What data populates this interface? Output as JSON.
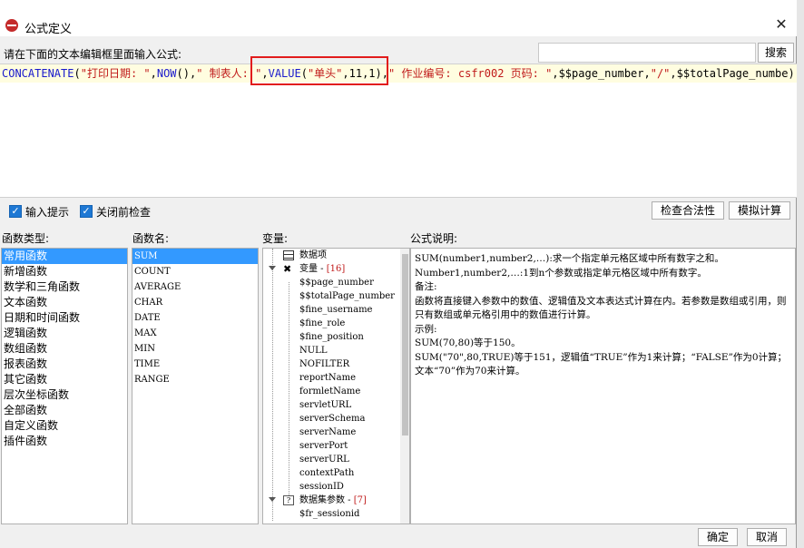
{
  "window": {
    "title": "公式定义",
    "close_glyph": "✕"
  },
  "prompt_label": "请在下面的文本编辑框里面输入公式:",
  "search": {
    "value": "",
    "button_label": "搜索"
  },
  "formula": {
    "segments": [
      {
        "text": "CONCATENATE",
        "kind": "fn"
      },
      {
        "text": "(",
        "kind": "punct"
      },
      {
        "text": "\"打印日期: \"",
        "kind": "str"
      },
      {
        "text": ",",
        "kind": "punct"
      },
      {
        "text": "NOW",
        "kind": "fn"
      },
      {
        "text": "(),",
        "kind": "punct"
      },
      {
        "text": "\" 制表人: \"",
        "kind": "str"
      },
      {
        "text": ",",
        "kind": "punct"
      },
      {
        "text": "VALUE",
        "kind": "fn"
      },
      {
        "text": "(",
        "kind": "punct"
      },
      {
        "text": "\"单头\"",
        "kind": "str"
      },
      {
        "text": ",11,1),",
        "kind": "punct"
      },
      {
        "text": "\" 作业编号: csfr002 页码: \"",
        "kind": "str"
      },
      {
        "text": ",$$page_number,",
        "kind": "punct"
      },
      {
        "text": "\"/\"",
        "kind": "str"
      },
      {
        "text": ",$$totalPage_numbe)",
        "kind": "punct"
      }
    ],
    "overflow_glyph": "ý"
  },
  "options": {
    "input_hint_label": "输入提示",
    "check_before_close_label": "关闭前检查",
    "input_hint_checked": true,
    "check_before_close_checked": true,
    "check_validity_button": "检查合法性",
    "simulate_button": "模拟计算"
  },
  "function_types": {
    "label": "函数类型:",
    "items": [
      "常用函数",
      "新增函数",
      "数学和三角函数",
      "文本函数",
      "日期和时间函数",
      "逻辑函数",
      "数组函数",
      "报表函数",
      "其它函数",
      "层次坐标函数",
      "全部函数",
      "自定义函数",
      "插件函数"
    ],
    "selected_index": 0
  },
  "function_names": {
    "label": "函数名:",
    "items": [
      "SUM",
      "COUNT",
      "AVERAGE",
      "CHAR",
      "DATE",
      "MAX",
      "MIN",
      "TIME",
      "RANGE"
    ],
    "selected_index": 0
  },
  "variables": {
    "label": "变量:",
    "root_data_item": "数据项",
    "variables_node": "变量 - [16]",
    "variable_items": [
      "$$page_number",
      "$$totalPage_number",
      "$fine_username",
      "$fine_role",
      "$fine_position",
      "NULL",
      "NOFILTER",
      "reportName",
      "formletName",
      "servletURL",
      "serverSchema",
      "serverName",
      "serverPort",
      "serverURL",
      "contextPath",
      "sessionID"
    ],
    "dataset_params_node": "数据集参数 - [7]",
    "dataset_items": [
      "$fr_sessionid"
    ]
  },
  "description": {
    "label": "公式说明:",
    "lines": [
      "SUM(number1,number2,…):求一个指定单元格区域中所有数字之和。",
      "Number1,number2,…:1到n个参数或指定单元格区域中所有数字。",
      "备注:",
      "函数将直接键入参数中的数值、逻辑值及文本表达式计算在内。若参数是数组或引用，则只有数组或单元格引用中的数值进行计算。",
      "示例:",
      "SUM(70,80)等于150。",
      "SUM(\"70\",80,TRUE)等于151，逻辑值“TRUE”作为1来计算；“FALSE”作为0计算；文本“70”作为70来计算。"
    ]
  },
  "footer": {
    "ok_label": "确定",
    "cancel_label": "取消"
  },
  "colors": {
    "function": "#1a1acc",
    "string": "#c01a1a",
    "selection": "#3399ff",
    "highlight_box": "#e21c1c",
    "formula_line_bg": "#fffde0"
  }
}
